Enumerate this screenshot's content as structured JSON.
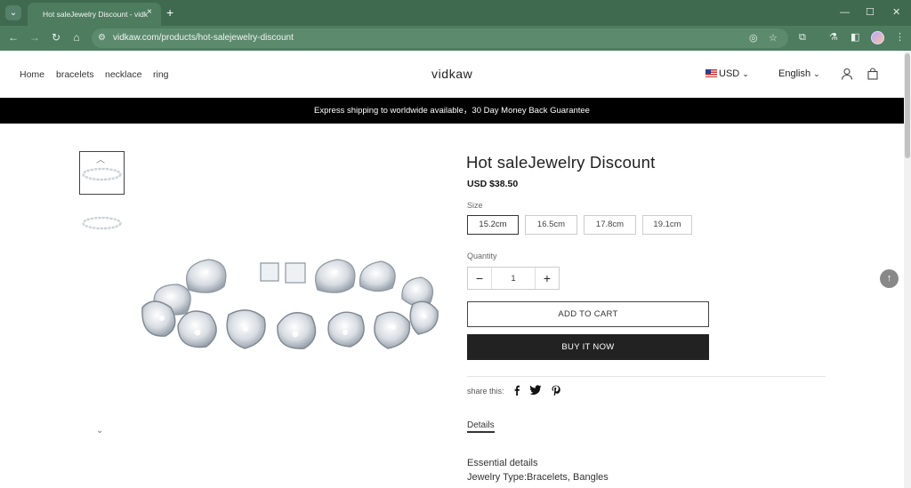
{
  "browser": {
    "tab_title": "Hot saleJewelry Discount - vidk",
    "url": "vidkaw.com/products/hot-salejewelry-discount",
    "tab_close": "×",
    "new_tab": "+"
  },
  "header": {
    "nav": [
      "Home",
      "bracelets",
      "necklace",
      "ring"
    ],
    "logo": "vidkaw",
    "currency": "USD",
    "language": "English"
  },
  "announcement": "Express shipping to worldwide available，30 Day Money Back Guarantee",
  "product": {
    "title": "Hot saleJewelry Discount",
    "price": "USD $38.50",
    "size_label": "Size",
    "sizes": [
      "15.2cm",
      "16.5cm",
      "17.8cm",
      "19.1cm"
    ],
    "selected_size": "15.2cm",
    "quantity_label": "Quantity",
    "quantity": "1",
    "add_to_cart": "ADD TO CART",
    "buy_now": "BUY IT NOW",
    "share_label": "share this:",
    "details_tab": "Details",
    "description": [
      "Essential details",
      "Jewelry Type:Bracelets, Bangles"
    ]
  },
  "icons": {
    "chevron": "⌄",
    "minus": "−",
    "plus": "+",
    "back_to_top": "↑"
  },
  "colors": {
    "browser_frame": "#3f6a4f",
    "announcement_bar": "#000000",
    "buy_button": "#222222"
  }
}
